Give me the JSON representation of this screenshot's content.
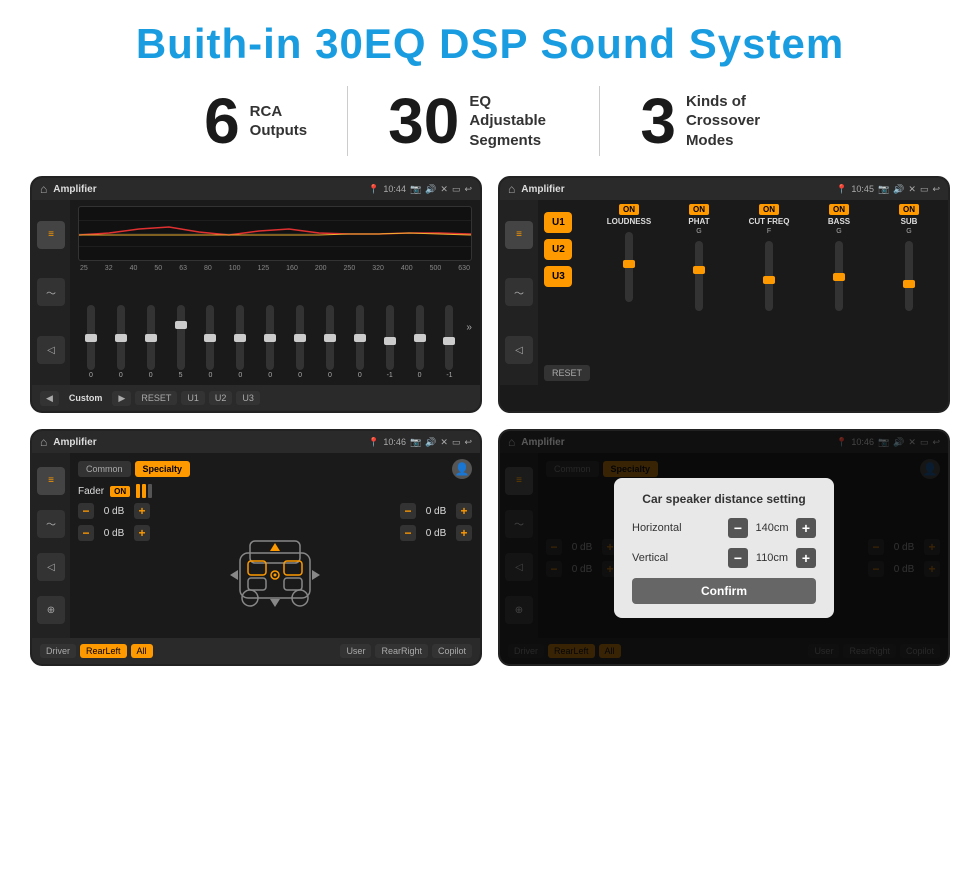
{
  "page": {
    "title": "Buith-in 30EQ DSP Sound System",
    "stats": [
      {
        "number": "6",
        "text": "RCA\nOutputs"
      },
      {
        "number": "30",
        "text": "EQ Adjustable\nSegments"
      },
      {
        "number": "3",
        "text": "Kinds of\nCrossover Modes"
      }
    ]
  },
  "screen1": {
    "statusBar": {
      "title": "Amplifier",
      "time": "10:44"
    },
    "freqLabels": [
      "25",
      "32",
      "40",
      "50",
      "63",
      "80",
      "100",
      "125",
      "160",
      "200",
      "250",
      "320",
      "400",
      "500",
      "630"
    ],
    "sliderValues": [
      "0",
      "0",
      "0",
      "5",
      "0",
      "0",
      "0",
      "0",
      "0",
      "0",
      "-1",
      "0",
      "-1"
    ],
    "bottomButtons": [
      "◀",
      "Custom",
      "▶",
      "RESET",
      "U1",
      "U2",
      "U3"
    ]
  },
  "screen2": {
    "statusBar": {
      "title": "Amplifier",
      "time": "10:45"
    },
    "uButtons": [
      "U1",
      "U2",
      "U3"
    ],
    "columns": [
      {
        "onBadge": "ON",
        "label": "LOUDNESS",
        "sublabel": ""
      },
      {
        "onBadge": "ON",
        "label": "PHAT",
        "sublabel": ""
      },
      {
        "onBadge": "ON",
        "label": "CUT FREQ",
        "sublabel": ""
      },
      {
        "onBadge": "ON",
        "label": "BASS",
        "sublabel": ""
      },
      {
        "onBadge": "ON",
        "label": "SUB",
        "sublabel": ""
      }
    ],
    "resetLabel": "RESET"
  },
  "screen3": {
    "statusBar": {
      "title": "Amplifier",
      "time": "10:46"
    },
    "tabs": [
      "Common",
      "Specialty"
    ],
    "faderLabel": "Fader",
    "onBadge": "ON",
    "dbRows": [
      {
        "value": "0 dB"
      },
      {
        "value": "0 dB"
      },
      {
        "value": "0 dB"
      },
      {
        "value": "0 dB"
      }
    ],
    "bottomButtons": [
      "Driver",
      "RearLeft",
      "All",
      "User",
      "RearRight",
      "Copilot"
    ]
  },
  "screen4": {
    "statusBar": {
      "title": "Amplifier",
      "time": "10:46"
    },
    "tabs": [
      "Common",
      "Specialty"
    ],
    "dialog": {
      "title": "Car speaker distance setting",
      "rows": [
        {
          "label": "Horizontal",
          "value": "140cm"
        },
        {
          "label": "Vertical",
          "value": "110cm"
        }
      ],
      "confirmLabel": "Confirm"
    },
    "bottomButtons": [
      "Driver",
      "RearLeft",
      "All",
      "User",
      "RearRight",
      "Copilot"
    ]
  }
}
